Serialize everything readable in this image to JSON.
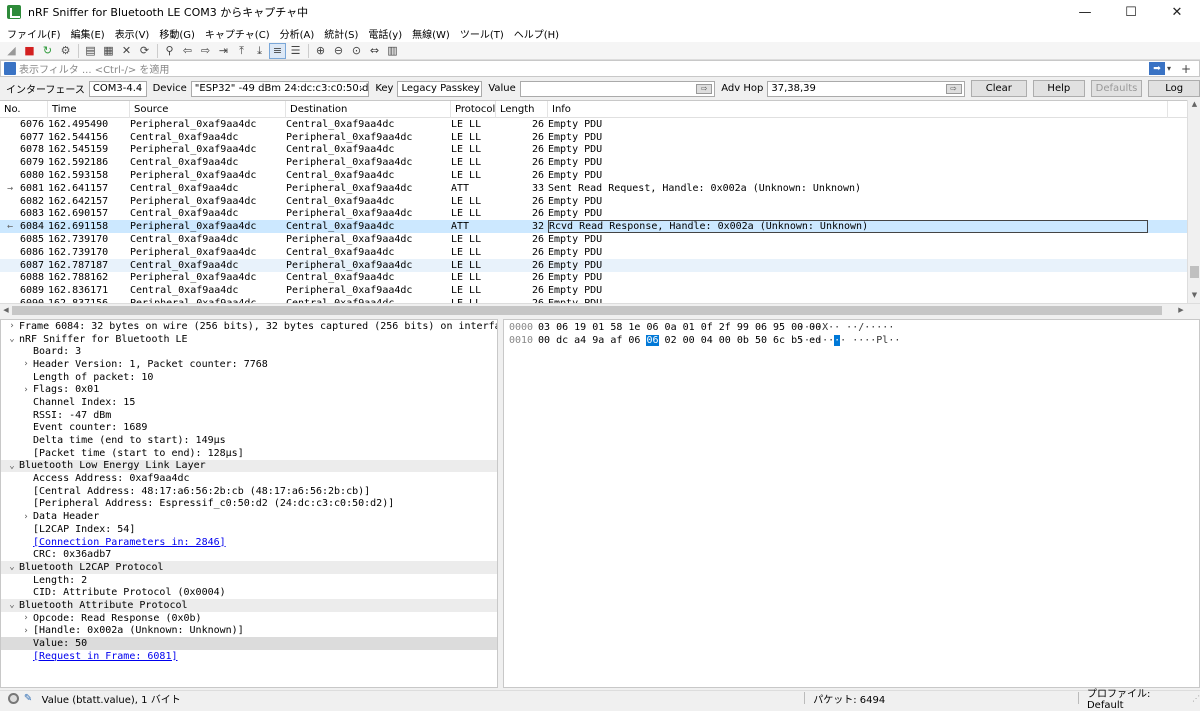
{
  "window": {
    "title": "nRF Sniffer for Bluetooth LE COM3 からキャプチャ中",
    "minimize": "—",
    "maximize": "☐",
    "close": "✕"
  },
  "menu": [
    "ファイル(F)",
    "編集(E)",
    "表示(V)",
    "移動(G)",
    "キャプチャ(C)",
    "分析(A)",
    "統計(S)",
    "電話(y)",
    "無線(W)",
    "ツール(T)",
    "ヘルプ(H)"
  ],
  "toolbar_icons": [
    "shark-fin-icon",
    "stop-icon",
    "restart-icon",
    "options-gear-icon",
    "open-file-icon",
    "save-file-icon",
    "close-file-icon",
    "reload-icon",
    "find-packet-icon",
    "go-back-icon",
    "go-forward-icon",
    "go-to-packet-icon",
    "go-first-icon",
    "go-last-icon",
    "auto-scroll-icon",
    "colorize-icon",
    "zoom-in-icon",
    "zoom-out-icon",
    "normal-size-icon",
    "resize-columns-icon",
    "layout-icon"
  ],
  "filter": {
    "placeholder": "表示フィルタ ... <Ctrl-/> を適用",
    "apply": "➡",
    "dropdown": "▾",
    "add": "+"
  },
  "capture": {
    "interface_label": "インターフェース",
    "interface_value": "COM3-4.4",
    "device_label": "Device",
    "device_value": "\"ESP32\"  -49 dBm  24:dc:c3:c0:50:d2  public",
    "key_label": "Key",
    "key_value": "Legacy Passkey",
    "value_label": "Value",
    "value_value": "",
    "advhop_label": "Adv Hop",
    "advhop_value": "37,38,39",
    "clear": "Clear",
    "help": "Help",
    "defaults": "Defaults",
    "log": "Log"
  },
  "packet_list": {
    "headers": [
      "No.",
      "Time",
      "Source",
      "Destination",
      "Protocol",
      "Length",
      "Info"
    ],
    "rows": [
      {
        "no": "6076",
        "time": "162.495490",
        "src": "Peripheral_0xaf9aa4dc",
        "dst": "Central_0xaf9aa4dc",
        "proto": "LE LL",
        "len": "26",
        "info": "Empty PDU",
        "mark": ""
      },
      {
        "no": "6077",
        "time": "162.544156",
        "src": "Central_0xaf9aa4dc",
        "dst": "Peripheral_0xaf9aa4dc",
        "proto": "LE LL",
        "len": "26",
        "info": "Empty PDU",
        "mark": ""
      },
      {
        "no": "6078",
        "time": "162.545159",
        "src": "Peripheral_0xaf9aa4dc",
        "dst": "Central_0xaf9aa4dc",
        "proto": "LE LL",
        "len": "26",
        "info": "Empty PDU",
        "mark": ""
      },
      {
        "no": "6079",
        "time": "162.592186",
        "src": "Central_0xaf9aa4dc",
        "dst": "Peripheral_0xaf9aa4dc",
        "proto": "LE LL",
        "len": "26",
        "info": "Empty PDU",
        "mark": ""
      },
      {
        "no": "6080",
        "time": "162.593158",
        "src": "Peripheral_0xaf9aa4dc",
        "dst": "Central_0xaf9aa4dc",
        "proto": "LE LL",
        "len": "26",
        "info": "Empty PDU",
        "mark": ""
      },
      {
        "no": "6081",
        "time": "162.641157",
        "src": "Central_0xaf9aa4dc",
        "dst": "Peripheral_0xaf9aa4dc",
        "proto": "ATT",
        "len": "33",
        "info": "Sent Read Request, Handle: 0x002a (Unknown: Unknown)",
        "mark": "→"
      },
      {
        "no": "6082",
        "time": "162.642157",
        "src": "Peripheral_0xaf9aa4dc",
        "dst": "Central_0xaf9aa4dc",
        "proto": "LE LL",
        "len": "26",
        "info": "Empty PDU",
        "mark": ""
      },
      {
        "no": "6083",
        "time": "162.690157",
        "src": "Central_0xaf9aa4dc",
        "dst": "Peripheral_0xaf9aa4dc",
        "proto": "LE LL",
        "len": "26",
        "info": "Empty PDU",
        "mark": ""
      },
      {
        "no": "6084",
        "time": "162.691158",
        "src": "Peripheral_0xaf9aa4dc",
        "dst": "Central_0xaf9aa4dc",
        "proto": "ATT",
        "len": "32",
        "info": "Rcvd Read Response, Handle: 0x002a (Unknown: Unknown)",
        "mark": "←"
      },
      {
        "no": "6085",
        "time": "162.739170",
        "src": "Central_0xaf9aa4dc",
        "dst": "Peripheral_0xaf9aa4dc",
        "proto": "LE LL",
        "len": "26",
        "info": "Empty PDU",
        "mark": ""
      },
      {
        "no": "6086",
        "time": "162.739170",
        "src": "Peripheral_0xaf9aa4dc",
        "dst": "Central_0xaf9aa4dc",
        "proto": "LE LL",
        "len": "26",
        "info": "Empty PDU",
        "mark": ""
      },
      {
        "no": "6087",
        "time": "162.787187",
        "src": "Central_0xaf9aa4dc",
        "dst": "Peripheral_0xaf9aa4dc",
        "proto": "LE LL",
        "len": "26",
        "info": "Empty PDU",
        "mark": ""
      },
      {
        "no": "6088",
        "time": "162.788162",
        "src": "Peripheral_0xaf9aa4dc",
        "dst": "Central_0xaf9aa4dc",
        "proto": "LE LL",
        "len": "26",
        "info": "Empty PDU",
        "mark": ""
      },
      {
        "no": "6089",
        "time": "162.836171",
        "src": "Central_0xaf9aa4dc",
        "dst": "Peripheral_0xaf9aa4dc",
        "proto": "LE LL",
        "len": "26",
        "info": "Empty PDU",
        "mark": ""
      },
      {
        "no": "6090",
        "time": "162.837156",
        "src": "Peripheral_0xaf9aa4dc",
        "dst": "Central_0xaf9aa4dc",
        "proto": "LE LL",
        "len": "26",
        "info": "Empty PDU",
        "mark": ""
      }
    ],
    "selected_no": "6084",
    "highlight_no": "6087"
  },
  "details": [
    {
      "indent": 0,
      "tw": "›",
      "text": "Frame 6084: 32 bytes on wire (256 bits), 32 bytes captured (256 bits) on interface COM3-4.4",
      "hdr": false
    },
    {
      "indent": 0,
      "tw": "⌄",
      "text": "nRF Sniffer for Bluetooth LE",
      "hdr": false
    },
    {
      "indent": 1,
      "tw": "",
      "text": "Board: 3",
      "hdr": false
    },
    {
      "indent": 1,
      "tw": "›",
      "text": "Header Version: 1, Packet counter: 7768",
      "hdr": false
    },
    {
      "indent": 1,
      "tw": "",
      "text": "Length of packet: 10",
      "hdr": false
    },
    {
      "indent": 1,
      "tw": "›",
      "text": "Flags: 0x01",
      "hdr": false
    },
    {
      "indent": 1,
      "tw": "",
      "text": "Channel Index: 15",
      "hdr": false
    },
    {
      "indent": 1,
      "tw": "",
      "text": "RSSI: -47 dBm",
      "hdr": false
    },
    {
      "indent": 1,
      "tw": "",
      "text": "Event counter: 1689",
      "hdr": false
    },
    {
      "indent": 1,
      "tw": "",
      "text": "Delta time (end to start): 149µs",
      "hdr": false
    },
    {
      "indent": 1,
      "tw": "",
      "text": "[Packet time (start to end): 128µs]",
      "hdr": false
    },
    {
      "indent": 0,
      "tw": "⌄",
      "text": "Bluetooth Low Energy Link Layer",
      "hdr": true
    },
    {
      "indent": 1,
      "tw": "",
      "text": "Access Address: 0xaf9aa4dc",
      "hdr": false
    },
    {
      "indent": 1,
      "tw": "",
      "text": "[Central Address: 48:17:a6:56:2b:cb (48:17:a6:56:2b:cb)]",
      "hdr": false
    },
    {
      "indent": 1,
      "tw": "",
      "text": "[Peripheral Address: Espressif_c0:50:d2 (24:dc:c3:c0:50:d2)]",
      "hdr": false
    },
    {
      "indent": 1,
      "tw": "›",
      "text": "Data Header",
      "hdr": false
    },
    {
      "indent": 1,
      "tw": "",
      "text": "[L2CAP Index: 54]",
      "hdr": false
    },
    {
      "indent": 1,
      "tw": "",
      "text": "[Connection Parameters in: 2846]",
      "hdr": false,
      "link": true
    },
    {
      "indent": 1,
      "tw": "",
      "text": "CRC: 0x36adb7",
      "hdr": false
    },
    {
      "indent": 0,
      "tw": "⌄",
      "text": "Bluetooth L2CAP Protocol",
      "hdr": true
    },
    {
      "indent": 1,
      "tw": "",
      "text": "Length: 2",
      "hdr": false
    },
    {
      "indent": 1,
      "tw": "",
      "text": "CID: Attribute Protocol (0x0004)",
      "hdr": false
    },
    {
      "indent": 0,
      "tw": "⌄",
      "text": "Bluetooth Attribute Protocol",
      "hdr": true
    },
    {
      "indent": 1,
      "tw": "›",
      "text": "Opcode: Read Response (0x0b)",
      "hdr": false
    },
    {
      "indent": 1,
      "tw": "›",
      "text": "[Handle: 0x002a (Unknown: Unknown)]",
      "hdr": false
    },
    {
      "indent": 1,
      "tw": "",
      "text": "Value: 50",
      "hdr": false,
      "sel": true
    },
    {
      "indent": 1,
      "tw": "",
      "text": "[Request in Frame: 6081]",
      "hdr": false,
      "link": true
    }
  ],
  "bytes": [
    {
      "offset": "0000",
      "hex": [
        "03",
        "06",
        "19",
        "01",
        "58",
        "1e",
        "06",
        "0a",
        "01",
        "0f",
        "2f",
        "99",
        "06",
        "95",
        "00",
        "00"
      ],
      "ascii_a": "····X·· ",
      "ascii_b": "··/·····",
      "hl": -1
    },
    {
      "offset": "0010",
      "hex": [
        "00",
        "dc",
        "a4",
        "9a",
        "af",
        "06",
        "06",
        "02",
        "00",
        "04",
        "00",
        "0b",
        "50",
        "6c",
        "b5",
        "ed"
      ],
      "ascii_a": "······",
      "ascii_hl": "·",
      "ascii_c": "· ····Pl··",
      "hl": 6
    }
  ],
  "status": {
    "field": "Value (btatt.value), 1 バイト",
    "packets": "パケット: 6494",
    "profile": "プロファイル: Default"
  }
}
